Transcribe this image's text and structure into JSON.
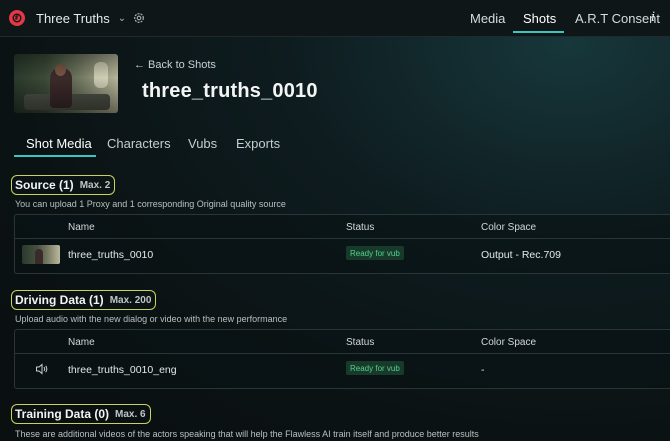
{
  "app": {
    "project_name": "Three Truths",
    "icons": {
      "logo": "flawless-logo",
      "project_menu": "chevron-down-icon",
      "settings": "settings-icon",
      "info": "info-icon"
    },
    "nav": [
      {
        "label": "Media"
      },
      {
        "label": "Shots",
        "active": true
      },
      {
        "label": "A.R.T Consent"
      }
    ],
    "accent_color": "#39c6c1"
  },
  "shot": {
    "back_label": "← Back to Shots",
    "title": "three_truths_0010"
  },
  "tabs": [
    {
      "label": "Shot Media",
      "active": true
    },
    {
      "label": "Characters"
    },
    {
      "label": "Vubs"
    },
    {
      "label": "Exports"
    }
  ],
  "sections": {
    "source": {
      "title": "Source (1)",
      "max": "Max. 2",
      "description": "You can upload 1 Proxy and 1 corresponding Original quality source",
      "columns": [
        "Name",
        "Status",
        "Color Space"
      ],
      "rows": [
        {
          "name": "three_truths_0010",
          "status": "Ready for vub",
          "color_space": "Output - Rec.709",
          "icon": "video-thumbnail"
        }
      ]
    },
    "driving": {
      "title": "Driving Data (1)",
      "max": "Max. 200",
      "description": "Upload audio with the new dialog or video with the new performance",
      "columns": [
        "Name",
        "Status",
        "Color Space"
      ],
      "rows": [
        {
          "name": "three_truths_0010_eng",
          "status": "Ready for vub",
          "color_space": "-",
          "icon": "speaker-icon"
        }
      ]
    },
    "training": {
      "title": "Training Data (0)",
      "max": "Max. 6",
      "description": "These are additional videos of the actors speaking that will help the Flawless AI train itself and produce better results"
    }
  },
  "status_color": "#56d08f"
}
